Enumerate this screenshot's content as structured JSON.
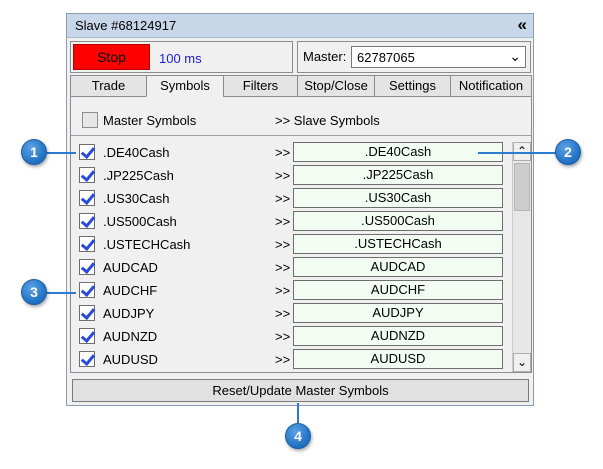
{
  "window": {
    "title": "Slave #68124917",
    "collapse_icon": "double-chevron-left-icon"
  },
  "controls": {
    "stop_label": "Stop",
    "interval": "100 ms",
    "master_label": "Master:",
    "master_value": "62787065"
  },
  "tabs": [
    {
      "label": "Trade"
    },
    {
      "label": "Symbols",
      "active": true
    },
    {
      "label": "Filters"
    },
    {
      "label": "Stop/Close"
    },
    {
      "label": "Settings"
    },
    {
      "label": "Notification"
    }
  ],
  "symbols_header": {
    "master": "Master Symbols",
    "slave": ">> Slave Symbols"
  },
  "rows": [
    {
      "master": ".DE40Cash",
      "arrow": ">>",
      "slave": ".DE40Cash"
    },
    {
      "master": ".JP225Cash",
      "arrow": ">>",
      "slave": ".JP225Cash"
    },
    {
      "master": ".US30Cash",
      "arrow": ">>",
      "slave": ".US30Cash"
    },
    {
      "master": ".US500Cash",
      "arrow": ">>",
      "slave": ".US500Cash"
    },
    {
      "master": ".USTECHCash",
      "arrow": ">>",
      "slave": ".USTECHCash"
    },
    {
      "master": "AUDCAD",
      "arrow": ">>",
      "slave": "AUDCAD"
    },
    {
      "master": "AUDCHF",
      "arrow": ">>",
      "slave": "AUDCHF"
    },
    {
      "master": "AUDJPY",
      "arrow": ">>",
      "slave": "AUDJPY"
    },
    {
      "master": "AUDNZD",
      "arrow": ">>",
      "slave": "AUDNZD"
    },
    {
      "master": "AUDUSD",
      "arrow": ">>",
      "slave": "AUDUSD"
    }
  ],
  "reset_label": "Reset/Update Master Symbols",
  "callouts": [
    "1",
    "2",
    "3",
    "4"
  ],
  "colors": {
    "stop": "#ff0000",
    "interval_text": "#1a1adb",
    "slave_field": "#f3fcf3",
    "callout": "#1f6fc2",
    "checkmark": "#2a4ad9"
  }
}
